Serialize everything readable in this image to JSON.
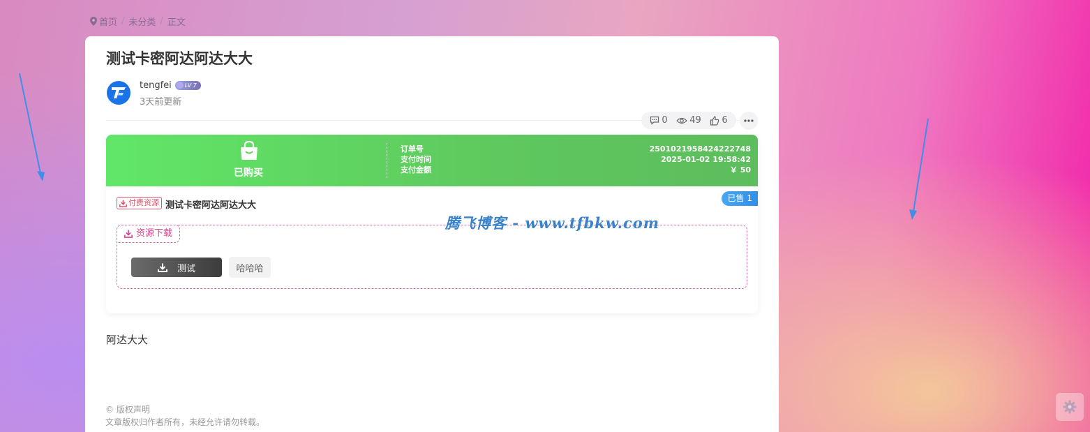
{
  "breadcrumb": {
    "items": [
      "首页",
      "未分类",
      "正文"
    ],
    "separator": "/"
  },
  "post": {
    "title": "测试卡密阿达阿达大大",
    "author": "tengfei",
    "level": "LV 7",
    "updated": "3天前更新",
    "stats": {
      "comments": "0",
      "views": "49",
      "likes": "6"
    },
    "body": "阿达大大"
  },
  "purchase": {
    "status": "已购买",
    "labels": [
      "订单号",
      "支付时间",
      "支付金额"
    ],
    "values": [
      "2501021958424222748",
      "2025-01-02 19:58:42",
      "￥ 50"
    ],
    "sold_badge": "已售 1",
    "paid_tag": "付费资源",
    "resource_title": "测试卡密阿达阿达大大",
    "download_tag": "资源下载",
    "buttons": {
      "primary": "测试",
      "secondary": "哈哈哈"
    }
  },
  "watermark": "腾飞博客 - www.tfbkw.com",
  "copyright": {
    "title": "© 版权声明",
    "text": "文章版权归作者所有，未经允许请勿转载。"
  },
  "colors": {
    "banner": "#5fd45f",
    "accent": "#d6458e",
    "sold": "#2f8fe8",
    "avatar": "#1a74e8"
  },
  "icons": [
    "map-pin-icon",
    "comment-icon",
    "eye-icon",
    "thumbs-up-icon",
    "more-icon",
    "shopping-bag-icon",
    "download-icon",
    "gear-icon",
    "arrow-icon"
  ]
}
